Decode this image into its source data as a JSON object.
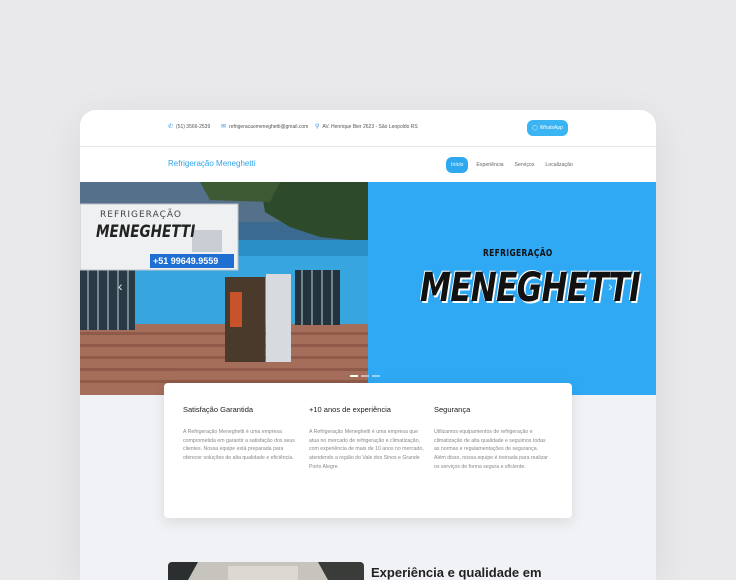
{
  "topbar": {
    "phone": "(51) 3566-2539",
    "email": "refrigeracaomeneghetti@gmail.com",
    "address": "AV. Henrique Bier 2623 - São Leopoldo RS",
    "whatsapp_label": "WhatsApp"
  },
  "nav": {
    "brand": "Refrigeração Meneghetti",
    "links": [
      "Início",
      "Experiência",
      "Serviços",
      "Localização"
    ]
  },
  "hero": {
    "sign_top": "REFRIGERAÇÃO",
    "sign_main": "MENEGHETTI",
    "sign_phone": "+51 99649.9559",
    "logo_small": "REFRIGERAÇÃO",
    "logo_big": "MENEGHETTI",
    "active_slide": 1,
    "slide_count": 3
  },
  "features": [
    {
      "title": "Satisfação Garantida",
      "text": "A Refrigeração Meneghetti é uma empresa comprometida em garantir a satisfação dos seus clientes. Nossa equipe está preparada para oferecer soluções de alta qualidade e eficiência."
    },
    {
      "title": "+10 anos de experiência",
      "text": "A Refrigeração Meneghetti é uma empresa que atua no mercado de refrigeração e climatização, com experiência de mais de 10 anos no mercado, atendendo a região do Vale dos Sinos e Grande Porto Alegre."
    },
    {
      "title": "Segurança",
      "text": "Utilizamos equipamentos de refrigeração e climatização de alta qualidade e seguimos todas as normas e regulamentações de segurança. Além disso, nossa equipe é treinada para realizar os serviços de forma segura e eficiente."
    }
  ],
  "experience": {
    "title": "Experiência e qualidade em"
  },
  "colors": {
    "accent": "#2fa9f3",
    "page_bg": "#e9e9ec"
  }
}
